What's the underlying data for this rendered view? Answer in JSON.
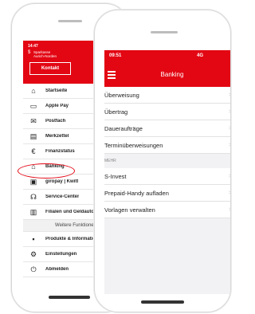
{
  "back_phone": {
    "time": "14:47",
    "bank_name": "Sparkasse\nAurich-Norden",
    "contact_button": "Kontakt",
    "menu": [
      {
        "icon": "home-icon",
        "glyph": "⌂",
        "label": "Startseite"
      },
      {
        "icon": "apple-pay-icon",
        "glyph": "▭",
        "label": "Apple Pay"
      },
      {
        "icon": "mail-icon",
        "glyph": "✉",
        "label": "Postfach"
      },
      {
        "icon": "notepad-icon",
        "glyph": "▤",
        "label": "Merkzettel"
      },
      {
        "icon": "euro-icon",
        "glyph": "€",
        "label": "Finanzstatus"
      },
      {
        "icon": "bank-icon",
        "glyph": "⌂",
        "label": "Banking"
      },
      {
        "icon": "giropay-icon",
        "glyph": "▣",
        "label": "giropay | Kwitt"
      },
      {
        "icon": "headset-icon",
        "glyph": "☊",
        "label": "Service-Center"
      },
      {
        "icon": "branch-icon",
        "glyph": "▥",
        "label": "Filialen und Geldautomaten"
      }
    ],
    "section_label": "Weitere Funktionen",
    "menu2": [
      {
        "icon": "sparkasse-icon",
        "glyph": "▪",
        "label": "Produkte & Informationen"
      },
      {
        "icon": "settings-icon",
        "glyph": "⚙",
        "label": "Einstellungen"
      },
      {
        "icon": "power-icon",
        "glyph": "⏻",
        "label": "Abmelden"
      }
    ]
  },
  "front_phone": {
    "time": "09:51",
    "signal": "4G",
    "title": "Banking",
    "items": [
      "Überweisung",
      "Übertrag",
      "Daueraufträge",
      "Terminüberweisungen"
    ],
    "section_label": "MEHR",
    "items2": [
      "S-Invest",
      "Prepaid-Handy aufladen",
      "Vorlagen verwalten"
    ],
    "chevron": ">"
  },
  "colors": {
    "brand_red": "#e30613"
  }
}
